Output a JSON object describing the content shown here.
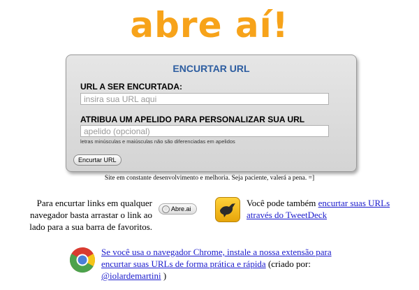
{
  "logo": "abre aí!",
  "form": {
    "title": "ENCURTAR URL",
    "url_label": "URL A SER ENCURTADA:",
    "url_placeholder": "insira sua URL aqui",
    "alias_label": "ATRIBUA UM APELIDO PARA PERSONALIZAR SUA URL (OPCIONAL):",
    "alias_placeholder": "apelido (opcional)",
    "hint": "letras minúsculas e maiúsculas não são diferenciadas em apelidos",
    "submit_label": "Encurtar URL"
  },
  "tagline": "Site em constante desenvolvimento e melhoria. Seja paciente, valerá a pena. =]",
  "bookmarklet": {
    "text": "Para encurtar links em qualquer navegador basta arrastar o link ao lado para a sua barra de favoritos.",
    "button_label": "Abre.ai"
  },
  "tweetdeck": {
    "text_prefix": "Você pode também ",
    "link": "encurtar suas URLs através do TweetDeck"
  },
  "chrome": {
    "link": "Se você usa o navegador Chrome, instale a nossa extensão para encurtar suas URLs de forma prática e rápida",
    "text_mid": " (criado por: ",
    "author_link": "@iolardemartini",
    "text_end": " )"
  },
  "colors": {
    "logo": "#f7a31a",
    "panel_title": "#2d5da0",
    "link": "#1a1acc"
  },
  "icons": [
    "tweetdeck-bird-icon",
    "chrome-icon",
    "bookmarklet-globe-icon"
  ]
}
